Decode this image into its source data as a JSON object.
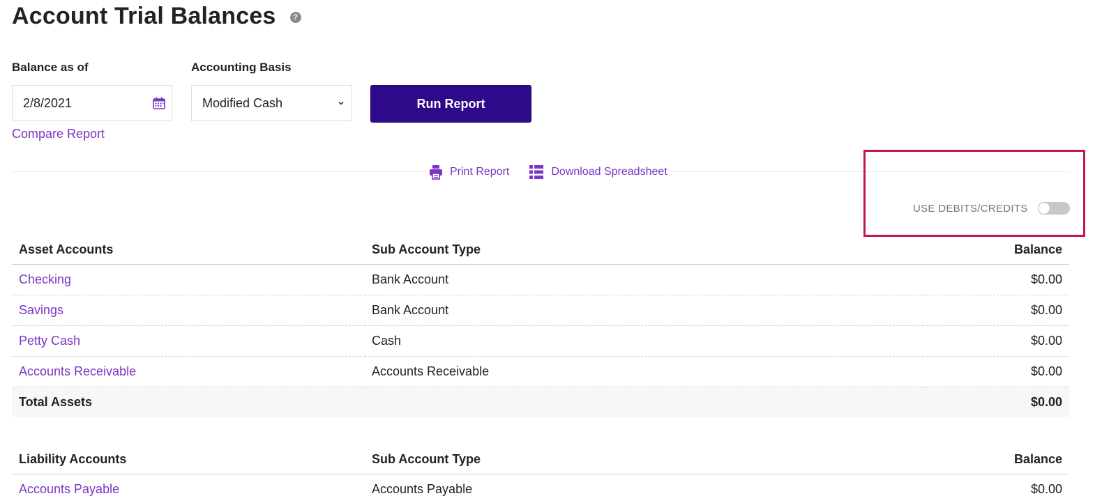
{
  "header": {
    "title": "Account Trial Balances",
    "help_glyph": "?"
  },
  "form": {
    "balance_label": "Balance as of",
    "balance_value": "2/8/2021",
    "basis_label": "Accounting Basis",
    "basis_value": "Modified Cash",
    "run_label": "Run Report",
    "compare_label": "Compare Report"
  },
  "actions": {
    "print_label": "Print Report",
    "download_label": "Download Spreadsheet"
  },
  "toggle": {
    "label": "USE DEBITS/CREDITS",
    "checked": false
  },
  "colors": {
    "accent": "#7b35c4",
    "primary_button": "#2e0a8a",
    "highlight": "#c8174a"
  },
  "assets": {
    "headers": {
      "name": "Asset Accounts",
      "type": "Sub Account Type",
      "balance": "Balance"
    },
    "rows": [
      {
        "name": "Checking",
        "type": "Bank Account",
        "balance": "$0.00"
      },
      {
        "name": "Savings",
        "type": "Bank Account",
        "balance": "$0.00"
      },
      {
        "name": "Petty Cash",
        "type": "Cash",
        "balance": "$0.00"
      },
      {
        "name": "Accounts Receivable",
        "type": "Accounts Receivable",
        "balance": "$0.00"
      }
    ],
    "total": {
      "label": "Total Assets",
      "balance": "$0.00"
    }
  },
  "liabilities": {
    "headers": {
      "name": "Liability Accounts",
      "type": "Sub Account Type",
      "balance": "Balance"
    },
    "rows": [
      {
        "name": "Accounts Payable",
        "type": "Accounts Payable",
        "balance": "$0.00"
      }
    ]
  }
}
